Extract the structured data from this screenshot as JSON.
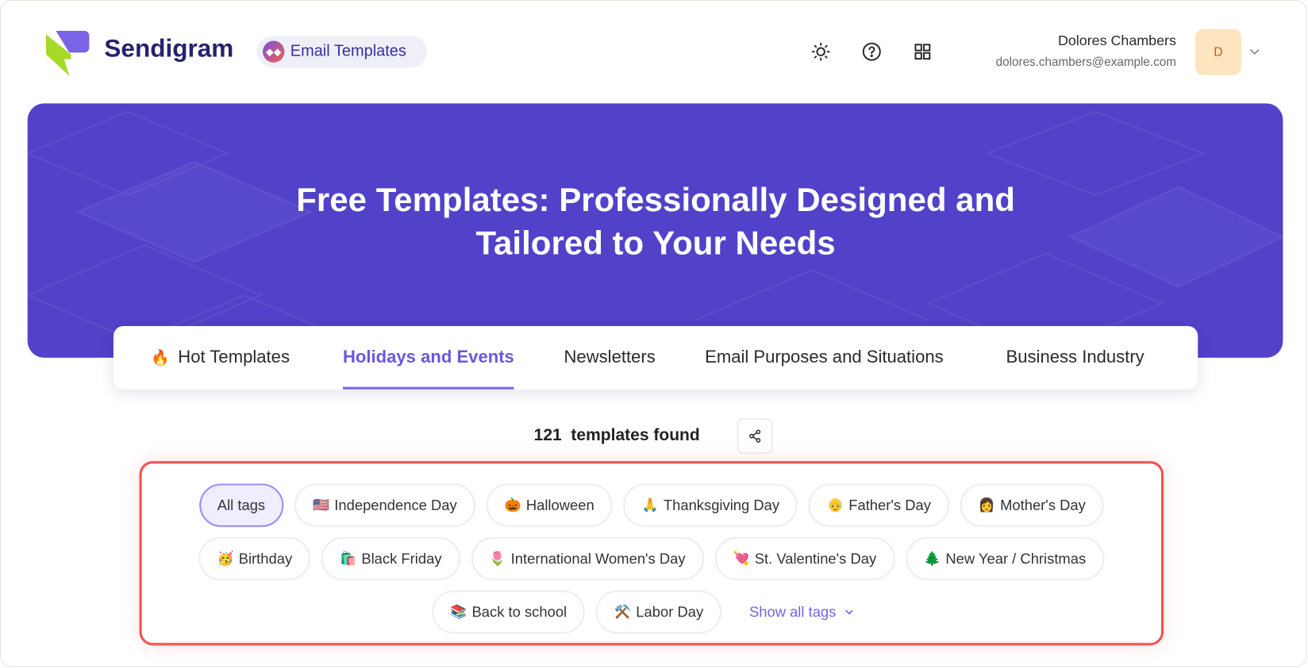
{
  "header": {
    "brand": "Sendigram",
    "product_badge": "Email Templates",
    "icons": [
      "sun-icon",
      "help-icon",
      "grid-icon"
    ],
    "user": {
      "name": "Dolores Chambers",
      "email": "dolores.chambers@example.com",
      "avatar_initial": "D"
    }
  },
  "hero": {
    "title_line1": "Free Templates: Professionally Designed and",
    "title_line2": "Tailored to Your Needs"
  },
  "tabs": [
    {
      "label": "Hot Templates",
      "emoji": "🔥"
    },
    {
      "label": "Holidays and Events",
      "active": true
    },
    {
      "label": "Newsletters"
    },
    {
      "label": "Email Purposes and Situations"
    },
    {
      "label": "Business Industry"
    }
  ],
  "results": {
    "count": "121",
    "label": "templates found"
  },
  "tags": [
    {
      "label": "All tags",
      "emoji": "",
      "active": true
    },
    {
      "label": "Independence Day",
      "emoji": "🇺🇸"
    },
    {
      "label": "Halloween",
      "emoji": "🎃"
    },
    {
      "label": "Thanksgiving Day",
      "emoji": "🙏"
    },
    {
      "label": "Father's Day",
      "emoji": "👴"
    },
    {
      "label": "Mother's Day",
      "emoji": "👩"
    },
    {
      "label": "Birthday",
      "emoji": "🥳"
    },
    {
      "label": "Black Friday",
      "emoji": "🛍️"
    },
    {
      "label": "International Women's Day",
      "emoji": "🌷"
    },
    {
      "label": "St. Valentine's Day",
      "emoji": "💘"
    },
    {
      "label": "New Year / Christmas",
      "emoji": "🌲"
    },
    {
      "label": "Back to school",
      "emoji": "📚"
    },
    {
      "label": "Labor Day",
      "emoji": "⚒️"
    }
  ],
  "show_all_tags": "Show all tags",
  "colors": {
    "accent": "#6b57e3",
    "hero": "#5142c9",
    "brand": "#27216f",
    "highlight_border": "#f25353"
  }
}
